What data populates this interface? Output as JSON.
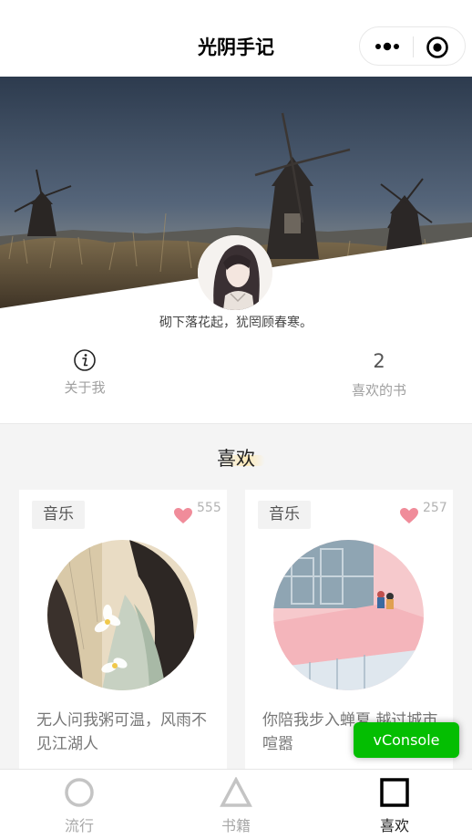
{
  "navbar": {
    "title": "光阴手记",
    "more_icon": "more-dots-icon",
    "record_icon": "record-circle-icon"
  },
  "profile": {
    "motto": "砌下落花起，犹罔顾春寒。",
    "about_icon": "info-icon",
    "about_label": "关于我",
    "liked_count": "2",
    "liked_label": "喜欢的书"
  },
  "favorites": {
    "title": "喜欢",
    "items": [
      {
        "tag": "音乐",
        "likes": "555",
        "text": "无人问我粥可温，风雨不见江湖人",
        "cover_icon": "girl-with-lotus-illustration"
      },
      {
        "tag": "音乐",
        "likes": "257",
        "text": "你陪我步入蝉夏 越过城市喧嚣",
        "cover_icon": "rooftop-couple-illustration"
      }
    ]
  },
  "vconsole": {
    "label": "vConsole"
  },
  "tabbar": {
    "items": [
      {
        "label": "流行",
        "icon": "circle-icon"
      },
      {
        "label": "书籍",
        "icon": "triangle-icon"
      },
      {
        "label": "喜欢",
        "icon": "square-icon",
        "active": true
      }
    ]
  },
  "colors": {
    "accent_green": "#04be02",
    "heart_pink": "#f08c9a",
    "section_bg": "#f4f4f4"
  }
}
